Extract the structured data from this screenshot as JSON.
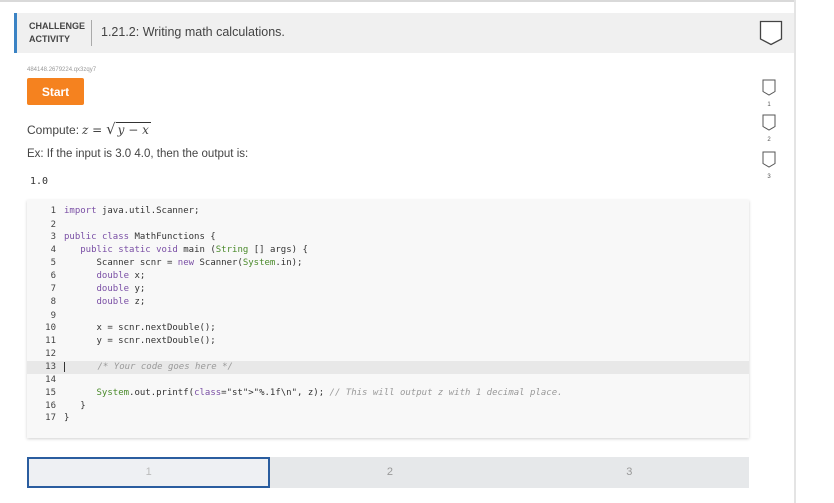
{
  "header": {
    "label_line1": "CHALLENGE",
    "label_line2": "ACTIVITY",
    "title": "1.21.2: Writing math calculations."
  },
  "activity": {
    "code_id": "484148.2679224.qx3zqy7",
    "start_label": "Start",
    "compute_label": "Compute:",
    "compute_lhs": "z =",
    "compute_radicand": "y − x",
    "example_text": "Ex: If the input is 3.0 4.0, then the output is:",
    "example_output": "1.0"
  },
  "editor": {
    "lines": [
      {
        "n": "1",
        "code": "import java.util.Scanner;"
      },
      {
        "n": "2",
        "code": ""
      },
      {
        "n": "3",
        "code": "public class MathFunctions {"
      },
      {
        "n": "4",
        "code": "   public static void main (String [] args) {"
      },
      {
        "n": "5",
        "code": "      Scanner scnr = new Scanner(System.in);"
      },
      {
        "n": "6",
        "code": "      double x;"
      },
      {
        "n": "7",
        "code": "      double y;"
      },
      {
        "n": "8",
        "code": "      double z;"
      },
      {
        "n": "9",
        "code": ""
      },
      {
        "n": "10",
        "code": "      x = scnr.nextDouble();"
      },
      {
        "n": "11",
        "code": "      y = scnr.nextDouble();"
      },
      {
        "n": "12",
        "code": ""
      },
      {
        "n": "13",
        "code": "      /* Your code goes here */"
      },
      {
        "n": "14",
        "code": ""
      },
      {
        "n": "15",
        "code": "      System.out.printf(\"%.1f\\n\", z); // This will output z with 1 decimal place."
      },
      {
        "n": "16",
        "code": "   }"
      },
      {
        "n": "17",
        "code": "}"
      }
    ]
  },
  "steps": [
    "1",
    "2",
    "3"
  ],
  "side_levels": [
    "1",
    "2",
    "3"
  ],
  "colors": {
    "accent": "#3b83c4",
    "start_button": "#f5821f",
    "step_border": "#2a5d9f"
  }
}
